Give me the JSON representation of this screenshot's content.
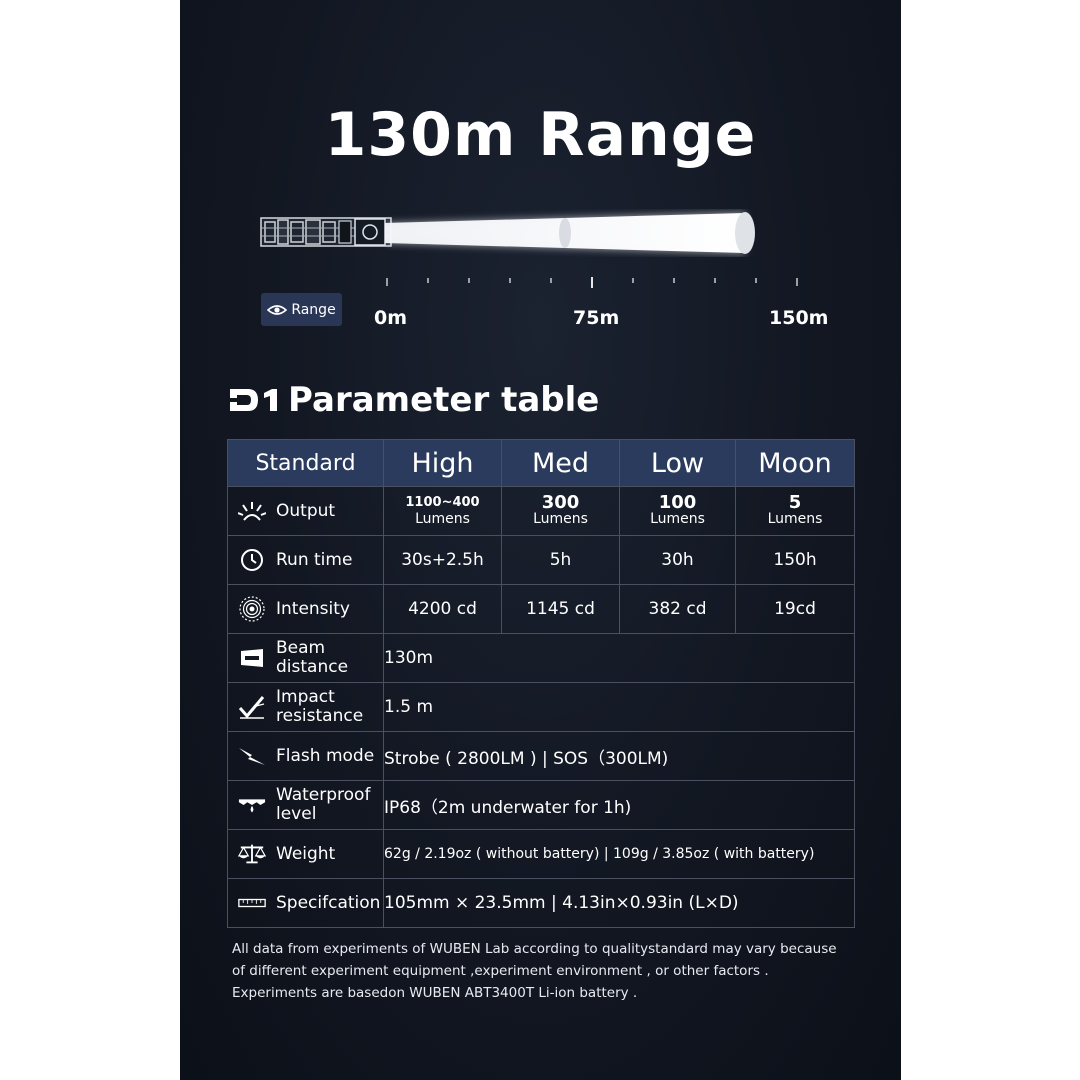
{
  "headline": "130m Range",
  "range_badge": {
    "label": "Range",
    "icon": "eye-icon"
  },
  "scale": {
    "start": "0m",
    "mid": "75m",
    "end": "150m"
  },
  "table_title": {
    "logo_text": "D1",
    "text": "Parameter table"
  },
  "table": {
    "header": [
      "Standard",
      "High",
      "Med",
      "Low",
      "Moon"
    ],
    "output": {
      "label": "Output",
      "icon": "light-rays-icon",
      "values": [
        {
          "number": "1100~400",
          "unit": "Lumens"
        },
        {
          "number": "300",
          "unit": "Lumens"
        },
        {
          "number": "100",
          "unit": "Lumens"
        },
        {
          "number": "5",
          "unit": "Lumens"
        }
      ]
    },
    "runtime": {
      "label": "Run time",
      "icon": "clock-icon",
      "values": [
        "30s+2.5h",
        "5h",
        "30h",
        "150h"
      ]
    },
    "intensity": {
      "label": "Intensity",
      "icon": "target-icon",
      "values": [
        "4200 cd",
        "1145 cd",
        "382 cd",
        "19cd"
      ]
    },
    "beam_distance": {
      "label": "Beam\ndistance",
      "icon": "beam-distance-icon",
      "value": "130m"
    },
    "impact": {
      "label": "Impact\nresistance",
      "icon": "impact-check-icon",
      "value": "1.5 m"
    },
    "flash": {
      "label": "Flash mode",
      "icon": "lightning-icon",
      "value": "Strobe ( 2800LM )  |  SOS（300LM)"
    },
    "waterproof": {
      "label": "Waterproof\nlevel",
      "icon": "waterproof-icon",
      "value": "IP68（2m underwater for 1h)"
    },
    "weight": {
      "label": "Weight",
      "icon": "scale-icon",
      "value": "62g / 2.19oz ( without battery) | 109g / 3.85oz ( with battery)"
    },
    "spec": {
      "label": "Specifcation",
      "icon": "ruler-icon",
      "value": "105mm × 23.5mm  | 4.13in×0.93in (L×D)"
    }
  },
  "footnote": "All data from experiments of WUBEN Lab according to qualitystandard may vary because\nof different experiment equipment ,experiment environment , or other factors .\nExperiments are basedon WUBEN ABT3400T Li-ion battery ."
}
